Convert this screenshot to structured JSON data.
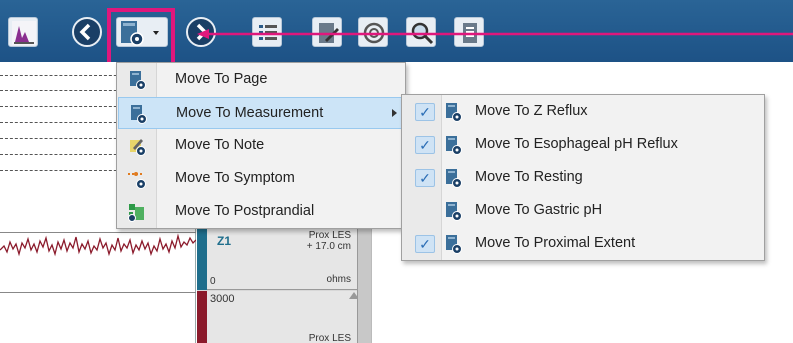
{
  "toolbar": {
    "buttons": [
      {
        "name": "app-logo-icon"
      },
      {
        "name": "back-arrow-icon"
      },
      {
        "name": "move-to-dropdown-icon"
      },
      {
        "name": "forward-arrow-icon"
      },
      {
        "name": "list-icon"
      },
      {
        "name": "edit-icon"
      },
      {
        "name": "refresh-icon"
      },
      {
        "name": "zoom-icon"
      },
      {
        "name": "document-icon"
      }
    ]
  },
  "channel": {
    "name": "Z1",
    "location_line1": "Prox LES",
    "location_line2": "+ 17.0 cm",
    "scale_min": "0",
    "unit": "ohms",
    "scale_max": "3000",
    "location2_line1": "Prox LES"
  },
  "menu": {
    "items": [
      {
        "label": "Move To Page",
        "icon": "page-icon"
      },
      {
        "label": "Move To Measurement",
        "icon": "measurement-icon",
        "highlighted": true,
        "has_submenu": true
      },
      {
        "label": "Move To Note",
        "icon": "note-icon"
      },
      {
        "label": "Move To Symptom",
        "icon": "symptom-icon"
      },
      {
        "label": "Move To Postprandial",
        "icon": "postprandial-icon"
      }
    ]
  },
  "submenu": {
    "items": [
      {
        "label": "Move To Z Reflux",
        "checked": true
      },
      {
        "label": "Move To Esophageal pH Reflux",
        "checked": true
      },
      {
        "label": "Move To Resting",
        "checked": true
      },
      {
        "label": "Move To Gastric pH",
        "checked": false
      },
      {
        "label": "Move To Proximal Extent",
        "checked": true
      }
    ],
    "check_glyph": "✓"
  },
  "colors": {
    "toolbar": "#1d5286",
    "highlight": "#e0177c",
    "menu_hover": "#cce4f7",
    "waveform": "#8b1a2b",
    "channel_teal": "#1f6e8c",
    "channel_red": "#8b1a2b"
  }
}
